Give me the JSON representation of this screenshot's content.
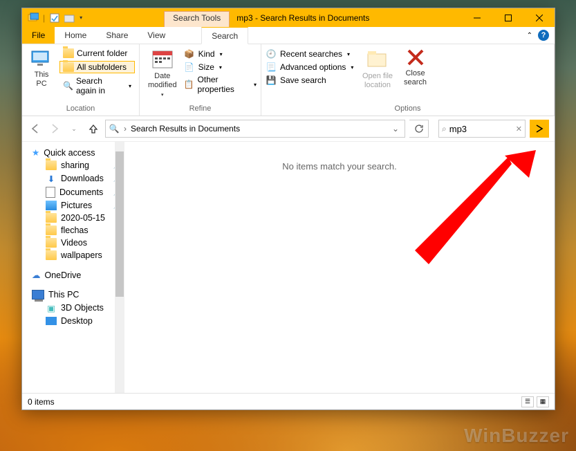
{
  "titlebar": {
    "tool_tab": "Search Tools",
    "title": "mp3 - Search Results in Documents"
  },
  "menu": {
    "file": "File",
    "home": "Home",
    "share": "Share",
    "view": "View",
    "search": "Search"
  },
  "ribbon": {
    "location": {
      "this_pc": "This\nPC",
      "current_folder": "Current folder",
      "all_subfolders": "All subfolders",
      "search_again": "Search again in",
      "label": "Location"
    },
    "refine": {
      "date_modified": "Date\nmodified",
      "kind": "Kind",
      "size": "Size",
      "other_properties": "Other properties",
      "label": "Refine"
    },
    "options": {
      "recent_searches": "Recent searches",
      "advanced_options": "Advanced options",
      "save_search": "Save search",
      "open_file_location": "Open file\nlocation",
      "close_search": "Close\nsearch",
      "label": "Options"
    }
  },
  "address": {
    "path": "Search Results in Documents"
  },
  "search": {
    "query": "mp3"
  },
  "main": {
    "empty": "No items match your search."
  },
  "sidebar": {
    "quick_access": "Quick access",
    "items": [
      {
        "label": "sharing",
        "pinned": true,
        "icon": "folder"
      },
      {
        "label": "Downloads",
        "pinned": true,
        "icon": "download"
      },
      {
        "label": "Documents",
        "pinned": true,
        "icon": "document"
      },
      {
        "label": "Pictures",
        "pinned": true,
        "icon": "pictures"
      },
      {
        "label": "2020-05-15",
        "pinned": false,
        "icon": "folder"
      },
      {
        "label": "flechas",
        "pinned": false,
        "icon": "folder"
      },
      {
        "label": "Videos",
        "pinned": false,
        "icon": "folder"
      },
      {
        "label": "wallpapers",
        "pinned": false,
        "icon": "folder"
      }
    ],
    "onedrive": "OneDrive",
    "this_pc": "This PC",
    "pc_items": [
      {
        "label": "3D Objects",
        "icon": "3d"
      },
      {
        "label": "Desktop",
        "icon": "desktop"
      }
    ]
  },
  "status": {
    "count": "0 items"
  }
}
